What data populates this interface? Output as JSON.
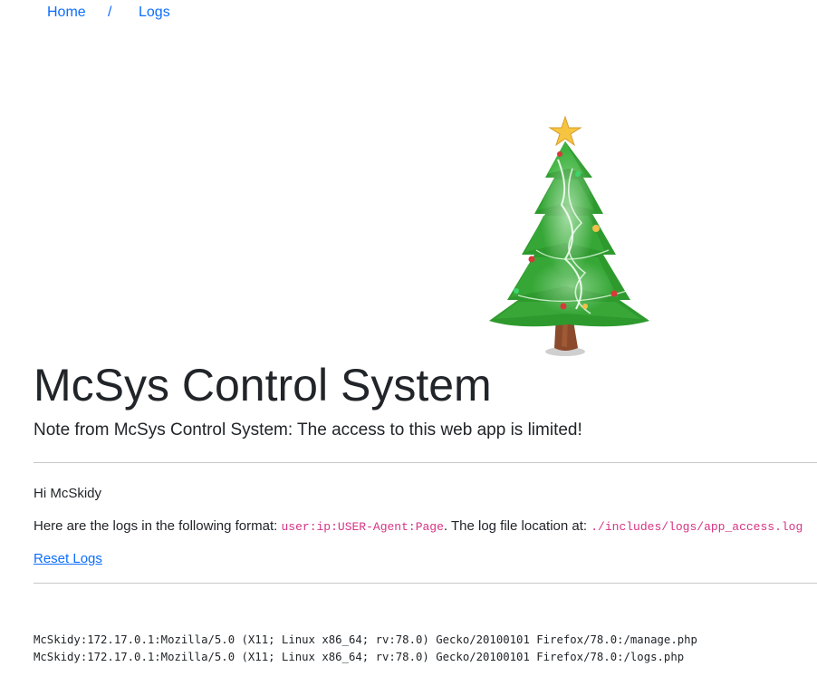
{
  "breadcrumb": {
    "home_label": "Home",
    "separator": "/",
    "logs_label": "Logs"
  },
  "hero": {
    "title": "McSys Control System",
    "note": "Note from McSys Control System: The access to this web app is limited!",
    "image_icon": "christmas-tree-icon"
  },
  "content": {
    "greeting": "Hi McSkidy",
    "format_prefix": "Here are the logs in the following format: ",
    "format_code": "user:ip:USER-Agent:Page",
    "location_prefix": ". The log file location at: ",
    "location_code": "./includes/logs/app_access.log",
    "reset_label": "Reset Logs"
  },
  "log_entries": [
    "McSkidy:172.17.0.1:Mozilla/5.0 (X11; Linux x86_64; rv:78.0) Gecko/20100101 Firefox/78.0:/manage.php",
    "McSkidy:172.17.0.1:Mozilla/5.0 (X11; Linux x86_64; rv:78.0) Gecko/20100101 Firefox/78.0:/logs.php"
  ],
  "colors": {
    "link": "#0d6efd",
    "code": "#d63384",
    "text": "#212529",
    "tree_green": "#2e9a2e",
    "trunk": "#8b4a2b",
    "star": "#f5c542"
  }
}
